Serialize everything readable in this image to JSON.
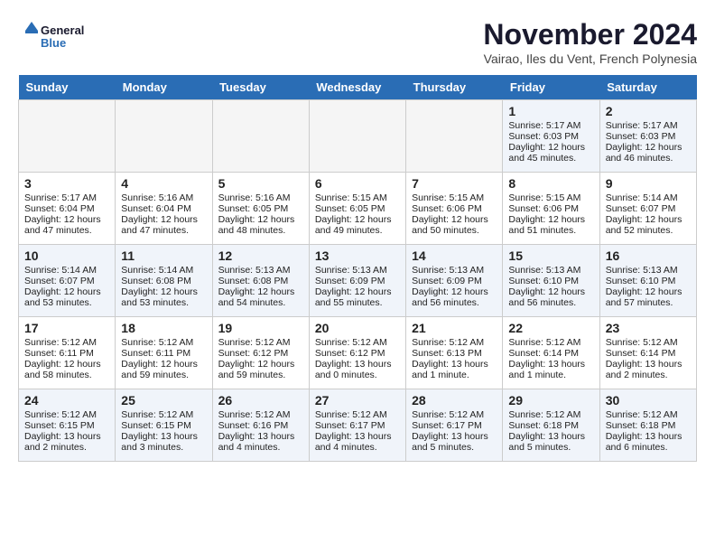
{
  "logo": {
    "line1": "General",
    "line2": "Blue"
  },
  "title": "November 2024",
  "subtitle": "Vairao, Iles du Vent, French Polynesia",
  "days_header": [
    "Sunday",
    "Monday",
    "Tuesday",
    "Wednesday",
    "Thursday",
    "Friday",
    "Saturday"
  ],
  "weeks": [
    [
      {
        "day": "",
        "data": ""
      },
      {
        "day": "",
        "data": ""
      },
      {
        "day": "",
        "data": ""
      },
      {
        "day": "",
        "data": ""
      },
      {
        "day": "",
        "data": ""
      },
      {
        "day": "1",
        "data": "Sunrise: 5:17 AM\nSunset: 6:03 PM\nDaylight: 12 hours\nand 45 minutes."
      },
      {
        "day": "2",
        "data": "Sunrise: 5:17 AM\nSunset: 6:03 PM\nDaylight: 12 hours\nand 46 minutes."
      }
    ],
    [
      {
        "day": "3",
        "data": "Sunrise: 5:17 AM\nSunset: 6:04 PM\nDaylight: 12 hours\nand 47 minutes."
      },
      {
        "day": "4",
        "data": "Sunrise: 5:16 AM\nSunset: 6:04 PM\nDaylight: 12 hours\nand 47 minutes."
      },
      {
        "day": "5",
        "data": "Sunrise: 5:16 AM\nSunset: 6:05 PM\nDaylight: 12 hours\nand 48 minutes."
      },
      {
        "day": "6",
        "data": "Sunrise: 5:15 AM\nSunset: 6:05 PM\nDaylight: 12 hours\nand 49 minutes."
      },
      {
        "day": "7",
        "data": "Sunrise: 5:15 AM\nSunset: 6:06 PM\nDaylight: 12 hours\nand 50 minutes."
      },
      {
        "day": "8",
        "data": "Sunrise: 5:15 AM\nSunset: 6:06 PM\nDaylight: 12 hours\nand 51 minutes."
      },
      {
        "day": "9",
        "data": "Sunrise: 5:14 AM\nSunset: 6:07 PM\nDaylight: 12 hours\nand 52 minutes."
      }
    ],
    [
      {
        "day": "10",
        "data": "Sunrise: 5:14 AM\nSunset: 6:07 PM\nDaylight: 12 hours\nand 53 minutes."
      },
      {
        "day": "11",
        "data": "Sunrise: 5:14 AM\nSunset: 6:08 PM\nDaylight: 12 hours\nand 53 minutes."
      },
      {
        "day": "12",
        "data": "Sunrise: 5:13 AM\nSunset: 6:08 PM\nDaylight: 12 hours\nand 54 minutes."
      },
      {
        "day": "13",
        "data": "Sunrise: 5:13 AM\nSunset: 6:09 PM\nDaylight: 12 hours\nand 55 minutes."
      },
      {
        "day": "14",
        "data": "Sunrise: 5:13 AM\nSunset: 6:09 PM\nDaylight: 12 hours\nand 56 minutes."
      },
      {
        "day": "15",
        "data": "Sunrise: 5:13 AM\nSunset: 6:10 PM\nDaylight: 12 hours\nand 56 minutes."
      },
      {
        "day": "16",
        "data": "Sunrise: 5:13 AM\nSunset: 6:10 PM\nDaylight: 12 hours\nand 57 minutes."
      }
    ],
    [
      {
        "day": "17",
        "data": "Sunrise: 5:12 AM\nSunset: 6:11 PM\nDaylight: 12 hours\nand 58 minutes."
      },
      {
        "day": "18",
        "data": "Sunrise: 5:12 AM\nSunset: 6:11 PM\nDaylight: 12 hours\nand 59 minutes."
      },
      {
        "day": "19",
        "data": "Sunrise: 5:12 AM\nSunset: 6:12 PM\nDaylight: 12 hours\nand 59 minutes."
      },
      {
        "day": "20",
        "data": "Sunrise: 5:12 AM\nSunset: 6:12 PM\nDaylight: 13 hours\nand 0 minutes."
      },
      {
        "day": "21",
        "data": "Sunrise: 5:12 AM\nSunset: 6:13 PM\nDaylight: 13 hours\nand 1 minute."
      },
      {
        "day": "22",
        "data": "Sunrise: 5:12 AM\nSunset: 6:14 PM\nDaylight: 13 hours\nand 1 minute."
      },
      {
        "day": "23",
        "data": "Sunrise: 5:12 AM\nSunset: 6:14 PM\nDaylight: 13 hours\nand 2 minutes."
      }
    ],
    [
      {
        "day": "24",
        "data": "Sunrise: 5:12 AM\nSunset: 6:15 PM\nDaylight: 13 hours\nand 2 minutes."
      },
      {
        "day": "25",
        "data": "Sunrise: 5:12 AM\nSunset: 6:15 PM\nDaylight: 13 hours\nand 3 minutes."
      },
      {
        "day": "26",
        "data": "Sunrise: 5:12 AM\nSunset: 6:16 PM\nDaylight: 13 hours\nand 4 minutes."
      },
      {
        "day": "27",
        "data": "Sunrise: 5:12 AM\nSunset: 6:17 PM\nDaylight: 13 hours\nand 4 minutes."
      },
      {
        "day": "28",
        "data": "Sunrise: 5:12 AM\nSunset: 6:17 PM\nDaylight: 13 hours\nand 5 minutes."
      },
      {
        "day": "29",
        "data": "Sunrise: 5:12 AM\nSunset: 6:18 PM\nDaylight: 13 hours\nand 5 minutes."
      },
      {
        "day": "30",
        "data": "Sunrise: 5:12 AM\nSunset: 6:18 PM\nDaylight: 13 hours\nand 6 minutes."
      }
    ]
  ]
}
